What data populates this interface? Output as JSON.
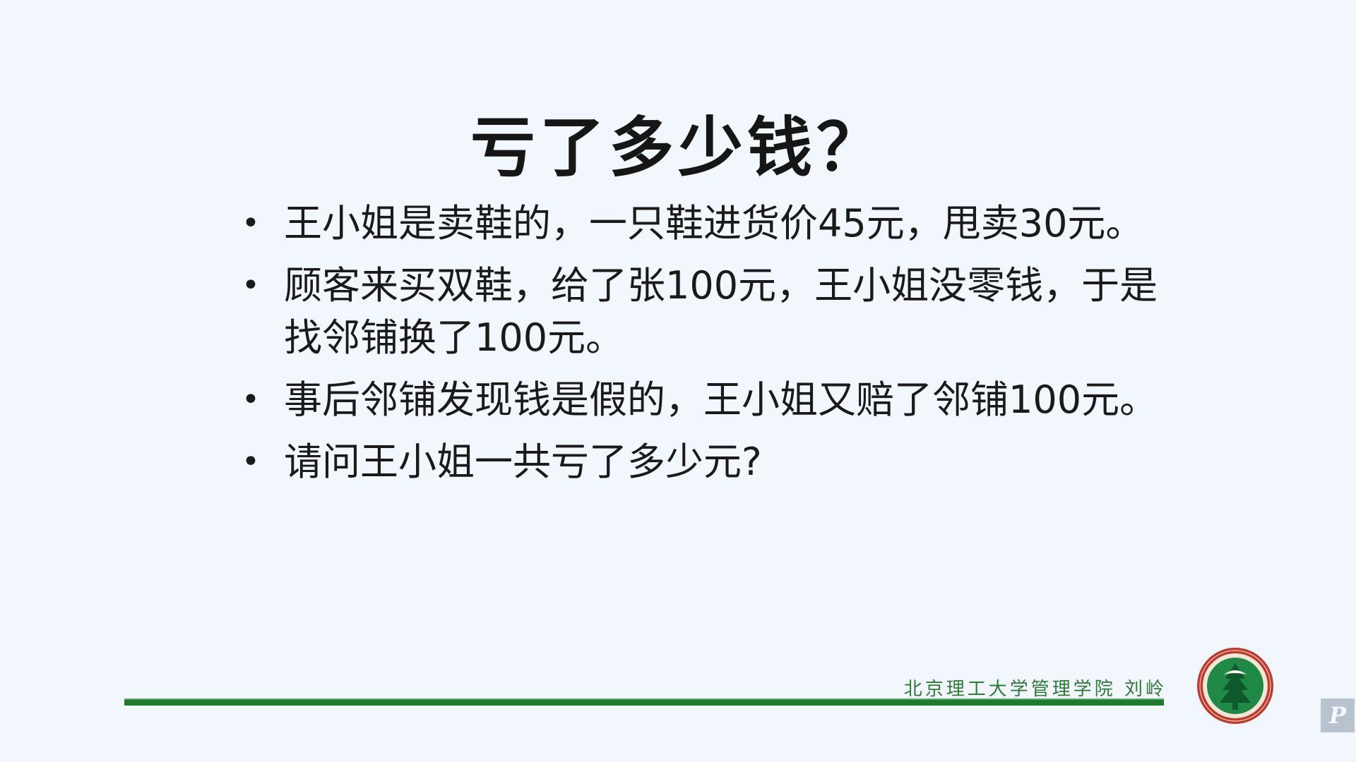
{
  "slide": {
    "title": "亏了多少钱？",
    "bullets": [
      "王小姐是卖鞋的，一只鞋进货价45元，甩卖30元。",
      "顾客来买双鞋，给了张100元，王小姐没零钱，于是找邻铺换了100元。",
      "事后邻铺发现钱是假的，王小姐又赔了邻铺100元。",
      "请问王小姐一共亏了多少元?"
    ],
    "bullet_marker": "•"
  },
  "footer": {
    "institution": "北京理工大学管理学院  刘岭",
    "line_color": "#1e7a2c",
    "text_color": "#2f7a37"
  },
  "logo": {
    "icon": "university-seal-icon",
    "ring_color": "#c0392b",
    "inner_color": "#1f8a46"
  },
  "corner_badge": {
    "icon": "pp-app-icon"
  }
}
